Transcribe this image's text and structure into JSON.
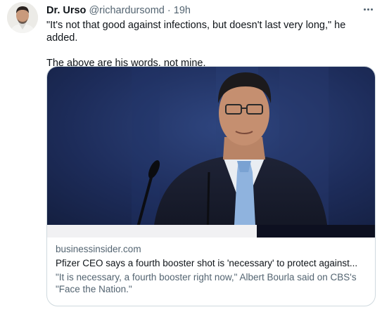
{
  "tweet": {
    "display_name": "Dr. Urso",
    "handle": "@richardursomd",
    "separator": "·",
    "time": "19h",
    "text_line1": "\"It's not that good against infections, but doesn't last very long,\" he added.",
    "text_line2": "The above are his words, not mine.",
    "more_icon": "more-horizontal-icon"
  },
  "card": {
    "domain": "businessinsider.com",
    "title": "Pfizer CEO says a fourth booster shot is 'necessary' to protect against...",
    "description": "\"It is necessary, a fourth booster right now,\" Albert Bourla said on CBS's \"Face the Nation.\""
  },
  "colors": {
    "text_primary": "#0f1419",
    "text_secondary": "#536471",
    "border": "#cfd9de",
    "photo_background": "#1a2a52"
  }
}
